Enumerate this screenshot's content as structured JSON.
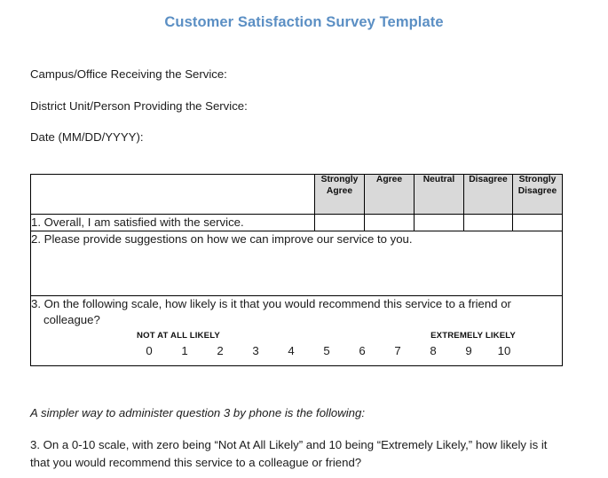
{
  "document": {
    "title": "Customer Satisfaction Survey Template",
    "title_color": "#5b8fc4"
  },
  "form_fields": [
    {
      "label": "Campus/Office Receiving the Service:"
    },
    {
      "label": "District Unit/Person Providing the Service:"
    },
    {
      "label": "Date (MM/DD/YYYY):"
    }
  ],
  "survey_table": {
    "header_blank": "",
    "scale_headers": [
      "Strongly Agree",
      "Agree",
      "Neutral",
      "Disagree",
      "Strongly Disagree"
    ],
    "header_background": "#d9d9d9",
    "questions": {
      "q1": {
        "text": "1. Overall, I am satisfied with the service.",
        "answer_cells": [
          "",
          "",
          "",
          "",
          ""
        ]
      },
      "q2": {
        "text": "2. Please provide suggestions on how we can improve our service to you.",
        "answer_value": ""
      },
      "q3": {
        "text": "3. On the following scale, how likely is it that you would recommend this service to a friend or colleague?",
        "scale": {
          "anchor_left": "NOT AT ALL LIKELY",
          "anchor_right": "EXTREMELY LIKELY",
          "values": [
            "0",
            "1",
            "2",
            "3",
            "4",
            "5",
            "6",
            "7",
            "8",
            "9",
            "10"
          ]
        }
      }
    }
  },
  "footer": {
    "note": "A simpler way to administer question 3 by phone is the following:",
    "paragraph": "3. On a 0-10 scale, with zero being “Not At All Likely” and 10 being “Extremely Likely,” how likely is it that you would recommend this service to a colleague or friend?"
  }
}
